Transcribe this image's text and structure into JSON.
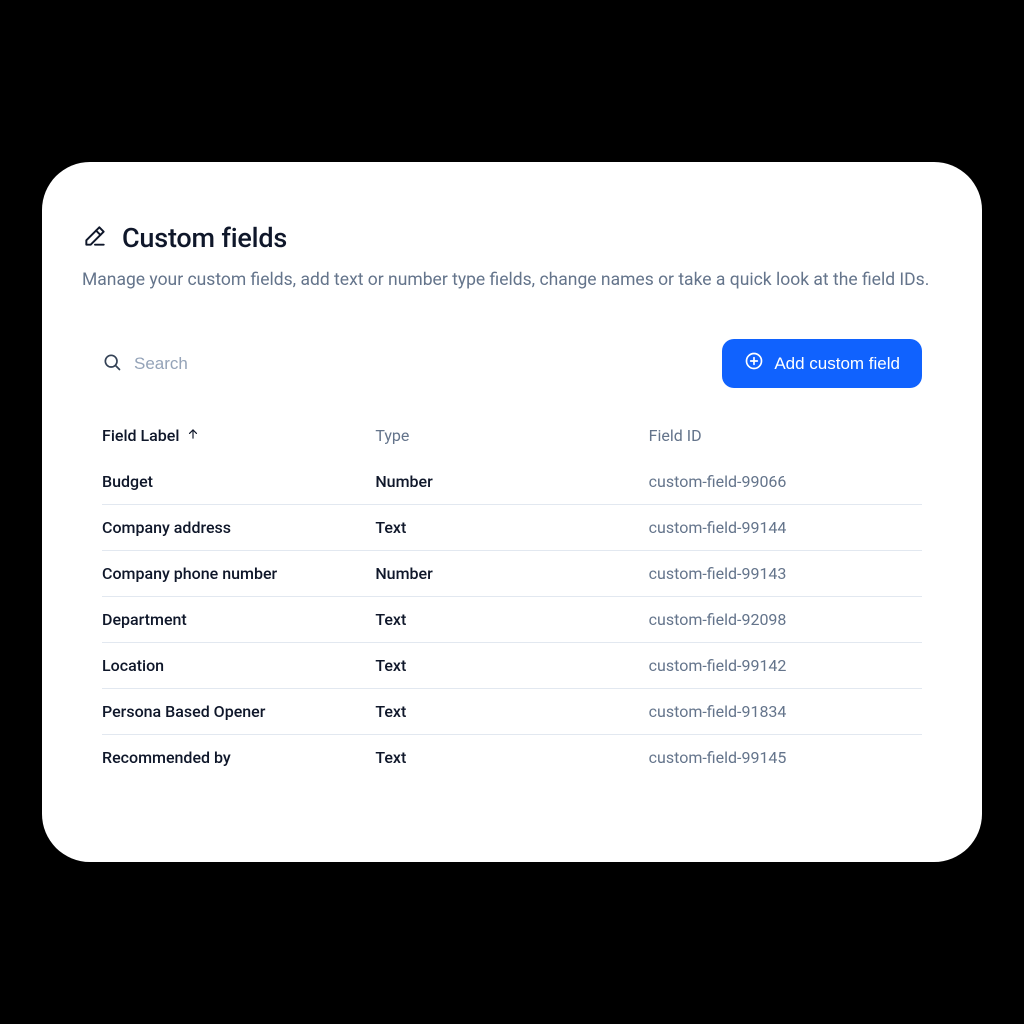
{
  "header": {
    "title": "Custom fields",
    "subtitle": "Manage your custom fields, add text or number type fields, change names or take a quick look at the field IDs."
  },
  "toolbar": {
    "search_placeholder": "Search",
    "add_button_label": "Add custom field"
  },
  "table": {
    "columns": {
      "field_label": "Field Label",
      "type": "Type",
      "field_id": "Field ID"
    },
    "sort_column": "field_label",
    "sort_direction": "asc",
    "rows": [
      {
        "label": "Budget",
        "type": "Number",
        "id": "custom-field-99066"
      },
      {
        "label": "Company address",
        "type": "Text",
        "id": "custom-field-99144"
      },
      {
        "label": "Company phone number",
        "type": "Number",
        "id": "custom-field-99143"
      },
      {
        "label": "Department",
        "type": "Text",
        "id": "custom-field-92098"
      },
      {
        "label": "Location",
        "type": "Text",
        "id": "custom-field-99142"
      },
      {
        "label": "Persona Based Opener",
        "type": "Text",
        "id": "custom-field-91834"
      },
      {
        "label": "Recommended by",
        "type": "Text",
        "id": "custom-field-99145"
      }
    ]
  }
}
